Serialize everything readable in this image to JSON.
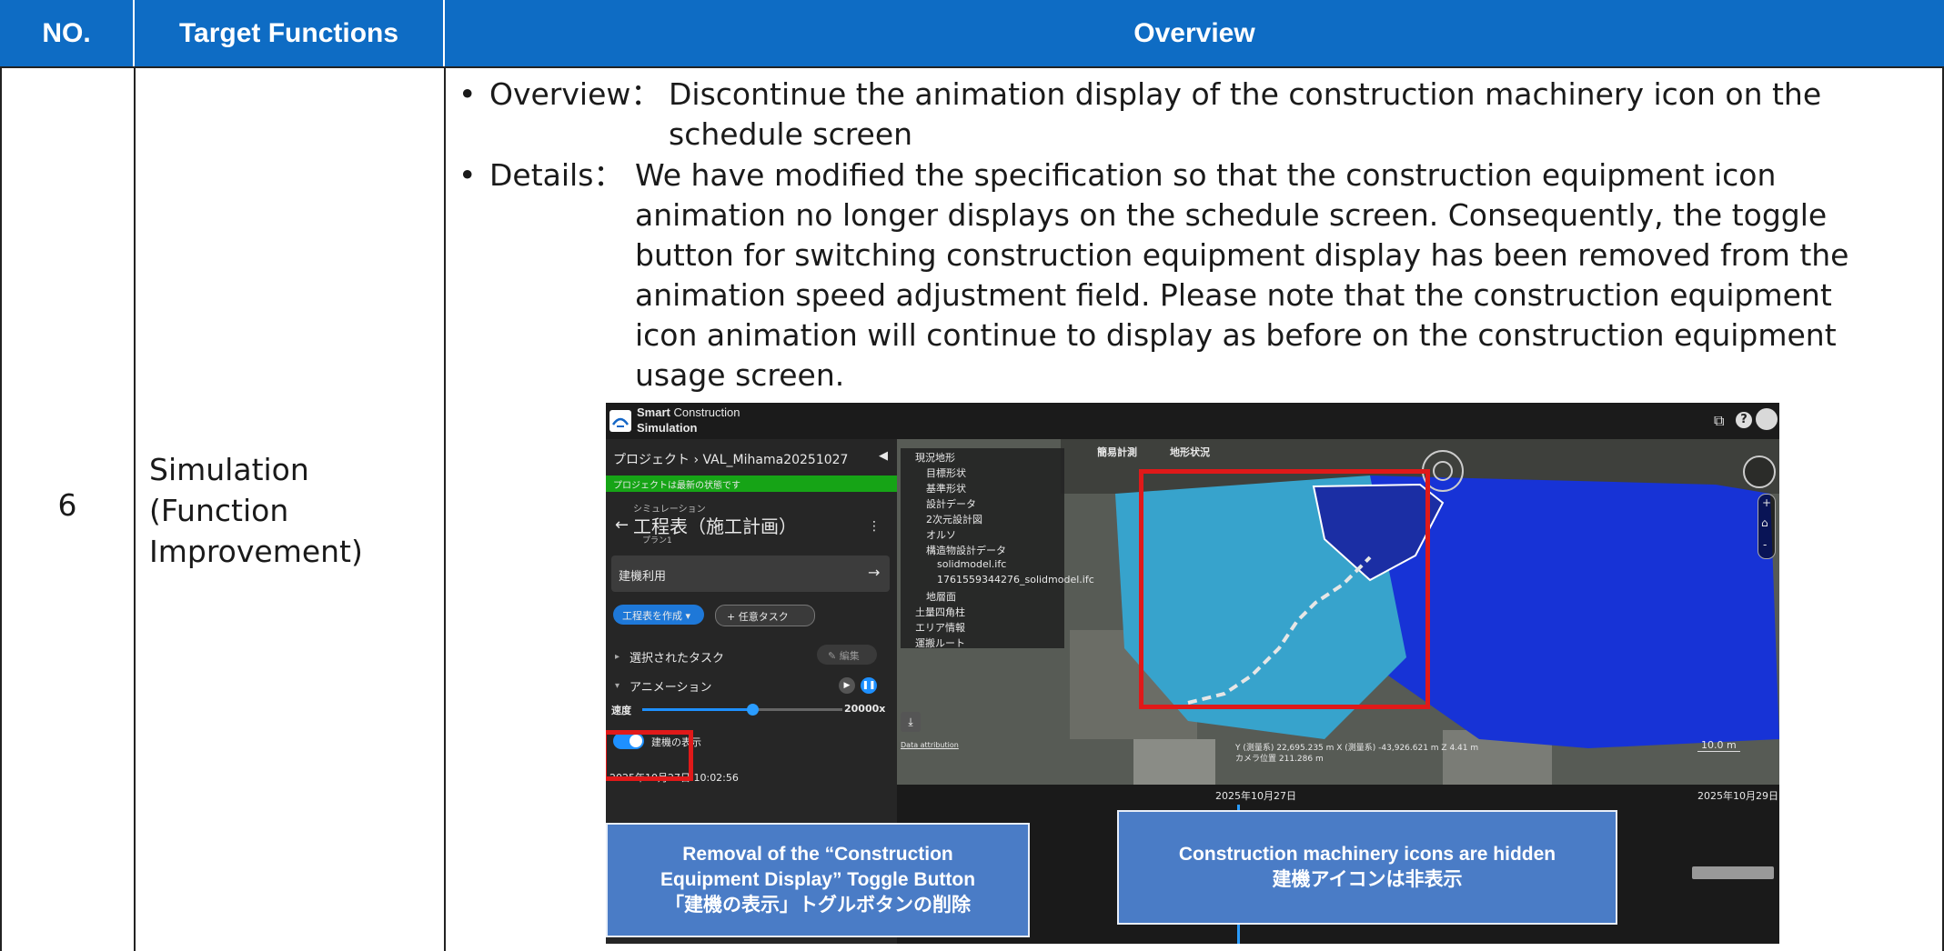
{
  "table": {
    "headers": {
      "no": "NO.",
      "target": "Target Functions",
      "overview": "Overview"
    },
    "row": {
      "no": "6",
      "target_lines": [
        "Simulation",
        "(Function",
        "Improvement)"
      ],
      "overview_label": "Overview：",
      "overview_lines": [
        "Discontinue the animation display of the construction machinery icon on the",
        "schedule screen"
      ],
      "details_label": "Details：",
      "details_lines": [
        "We have modified the specification so that the construction equipment icon",
        "animation no longer displays on the schedule screen. Consequently, the toggle",
        "button for switching construction equipment display has been removed from the",
        "animation speed adjustment field. Please note that the construction equipment",
        "icon animation will continue to display as before on the construction equipment",
        "usage screen."
      ]
    }
  },
  "screenshot": {
    "app_name_bold": "Smart",
    "app_name_rest": "Construction",
    "app_name_line2": "Simulation",
    "breadcrumb": "プロジェクト › VAL_Mihama20251027",
    "status_banner": "プロジェクトは最新の状態です",
    "sim_small": "シミュレーション",
    "page_title": "工程表（施工計画）",
    "plan_label": "プラン1",
    "machine_use": "建機利用",
    "create_schedule": "工程表を作成 ▾",
    "any_task": "+ 任意タスク",
    "selected_task": "選択されたタスク",
    "edit": "✎ 編集",
    "animation": "アニメーション",
    "speed_label": "速度",
    "speed_value": "20000x",
    "speed_fraction": 0.55,
    "toggle_label": "建機の表示",
    "datetime": "2025年10月27日 10:02:56",
    "layers": [
      "現況地形",
      "目標形状",
      "基準形状",
      "設計データ",
      "2次元設計図",
      "オルソ",
      "構造物設計データ",
      "solidmodel.ifc",
      "1761559344276_solidmodel.ifc",
      "地層面",
      "土量四角柱",
      "エリア情報",
      "運搬ルート"
    ],
    "map_tabs": [
      "簡易計測",
      "地形状況"
    ],
    "coords": "Y (測量系) 22,695.235 m    X (測量系) -43,926.621 m    Z 4.41 m",
    "camera": "カメラ位置 211.286 m",
    "scale": "10.0 m",
    "data_attribution": "Data attribution",
    "tl_date1": "2025年10月27日",
    "tl_date2": "2025年10月29日"
  },
  "callouts": {
    "left_lines": [
      "Removal of the “Construction",
      "Equipment Display” Toggle Button",
      "「建機の表示」トグルボタンの削除"
    ],
    "right_lines": [
      "Construction machinery icons are hidden",
      "建機アイコンは非表示"
    ]
  },
  "colors": {
    "header_bg": "#0e6cc4",
    "highlight": "#e01919",
    "callout_bg": "#4a7cc6",
    "toggle_on": "#1e90ff"
  }
}
